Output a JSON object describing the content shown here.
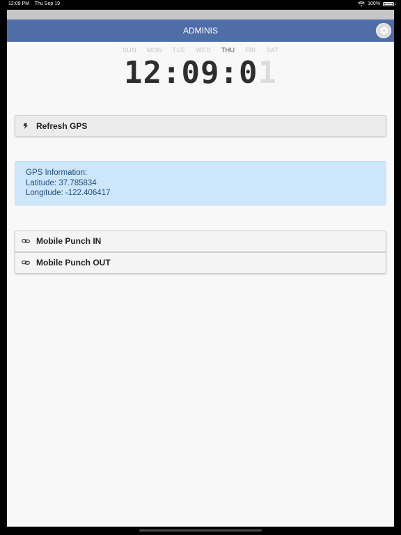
{
  "status_bar": {
    "time": "12:09 PM",
    "date": "Thu Sep 19",
    "battery": "100%"
  },
  "header": {
    "title": "ADMINIS"
  },
  "weekdays": [
    "SUN",
    "MON",
    "TUE",
    "WED",
    "THU",
    "FRI",
    "SAT"
  ],
  "active_weekday": "THU",
  "clock": {
    "main": "12:09:0",
    "last_digit": "1"
  },
  "buttons": {
    "refresh": "Refresh GPS",
    "punch_in": "Mobile Punch IN",
    "punch_out": "Mobile Punch OUT"
  },
  "gps": {
    "heading": "GPS Information:",
    "latitude": "Latitude: 37.785834",
    "longitude": "Longitude: -122.406417"
  },
  "colors": {
    "header_bg": "#4f6ea8",
    "info_bg": "#cde6fb",
    "info_text": "#1f4d7f"
  }
}
